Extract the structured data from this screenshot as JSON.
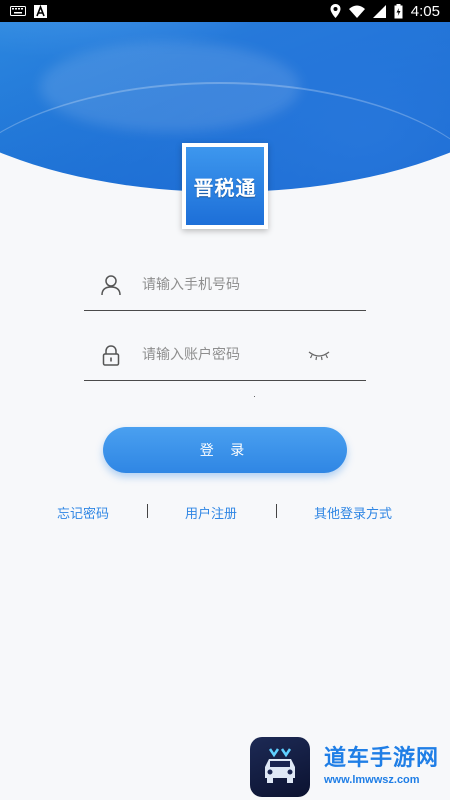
{
  "status_bar": {
    "time": "4:05",
    "icons": [
      "keyboard-icon",
      "a-notification-icon",
      "location-icon",
      "wifi-icon",
      "signal-icon",
      "battery-icon"
    ]
  },
  "app": {
    "logo_text": "晋税通",
    "brand_color": "#2f86e4"
  },
  "form": {
    "phone_placeholder": "请输入手机号码",
    "password_placeholder": "请输入账户密码",
    "phone_value": "",
    "password_value": ""
  },
  "login_button": {
    "label": "登 录"
  },
  "links": {
    "forgot_password": "忘记密码",
    "register": "用户注册",
    "other_login": "其他登录方式"
  },
  "watermark": {
    "title": "道车手游网",
    "url": "www.lmwwsz.com"
  }
}
